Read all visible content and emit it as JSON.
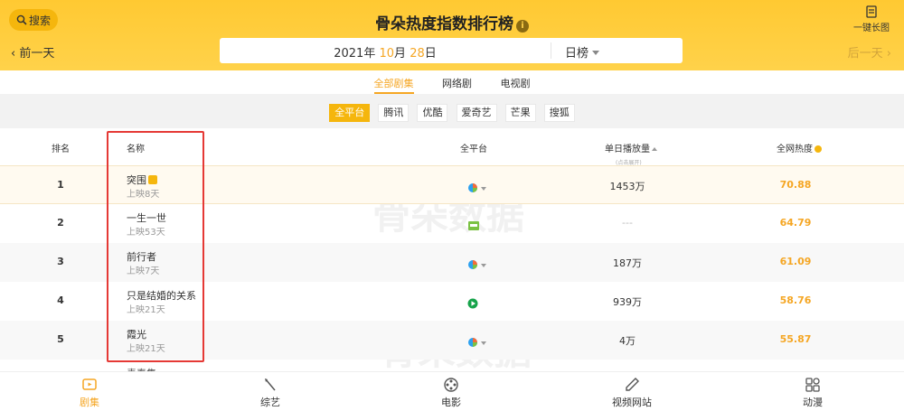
{
  "header": {
    "search_label": "搜索",
    "title": "骨朵热度指数排行榜",
    "long_pic_label": "一键长图",
    "prev_day": "前一天",
    "next_day": "后一天"
  },
  "date": {
    "year": "2021",
    "year_unit": "年",
    "month": "10",
    "month_unit": "月",
    "day": "28",
    "day_unit": "日",
    "range": "日榜"
  },
  "category_tabs": [
    {
      "label": "全部剧集",
      "active": true
    },
    {
      "label": "网络剧",
      "active": false
    },
    {
      "label": "电视剧",
      "active": false
    }
  ],
  "platforms": [
    {
      "label": "全平台",
      "active": true
    },
    {
      "label": "腾讯",
      "active": false
    },
    {
      "label": "优酷",
      "active": false
    },
    {
      "label": "爱奇艺",
      "active": false
    },
    {
      "label": "芒果",
      "active": false
    },
    {
      "label": "搜狐",
      "active": false
    }
  ],
  "table_headers": {
    "rank": "排名",
    "name": "名称",
    "platform": "全平台",
    "plays": "单日播放量",
    "plays_sub": "(点击展开)",
    "heat": "全网热度"
  },
  "rows": [
    {
      "rank": "1",
      "name": "突围",
      "days": "上映8天",
      "icon": "multi-platform-icon",
      "plays": "1453万",
      "heat": "70.88"
    },
    {
      "rank": "2",
      "name": "一生一世",
      "days": "上映53天",
      "icon": "tencent-video-icon",
      "plays": "---",
      "heat": "64.79"
    },
    {
      "rank": "3",
      "name": "前行者",
      "days": "上映7天",
      "icon": "multi-platform-icon",
      "plays": "187万",
      "heat": "61.09"
    },
    {
      "rank": "4",
      "name": "只是结婚的关系",
      "days": "上映21天",
      "icon": "play-triangle-icon",
      "plays": "939万",
      "heat": "58.76"
    },
    {
      "rank": "5",
      "name": "霞光",
      "days": "上映21天",
      "icon": "multi-platform-icon",
      "plays": "4万",
      "heat": "55.87"
    }
  ],
  "partial_row_name": "青春集",
  "watermark": "骨朵数据",
  "bottom_nav": [
    {
      "label": "剧集",
      "icon": "tv-icon",
      "active": true
    },
    {
      "label": "综艺",
      "icon": "wand-icon",
      "active": false
    },
    {
      "label": "电影",
      "icon": "film-reel-icon",
      "active": false
    },
    {
      "label": "视频网站",
      "icon": "pen-icon",
      "active": false
    },
    {
      "label": "动漫",
      "icon": "grid-icon",
      "active": false
    }
  ],
  "colors": {
    "accent": "#f5a623",
    "header_bg": "#ffc932",
    "highlight_border": "#e53935"
  }
}
